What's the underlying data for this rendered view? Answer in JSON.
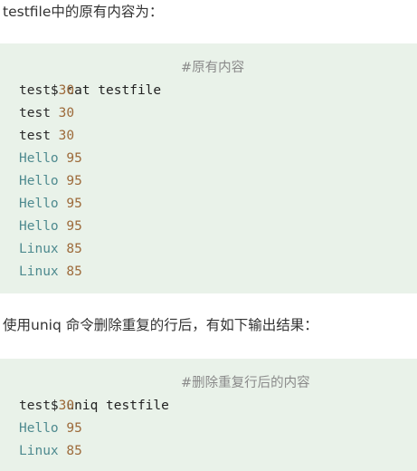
{
  "intro_text": "testfile中的原有内容为：",
  "block1": {
    "command": "$ cat testfile",
    "comment": "#原有内容",
    "lines": [
      {
        "word": "test",
        "num": "30",
        "cap": false
      },
      {
        "word": "test",
        "num": "30",
        "cap": false
      },
      {
        "word": "test",
        "num": "30",
        "cap": false
      },
      {
        "word": "Hello",
        "num": "95",
        "cap": true
      },
      {
        "word": "Hello",
        "num": "95",
        "cap": true
      },
      {
        "word": "Hello",
        "num": "95",
        "cap": true
      },
      {
        "word": "Hello",
        "num": "95",
        "cap": true
      },
      {
        "word": "Linux",
        "num": "85",
        "cap": true
      },
      {
        "word": "Linux",
        "num": "85",
        "cap": true
      }
    ]
  },
  "middle_text": "使用uniq 命令删除重复的行后，有如下输出结果：",
  "block2": {
    "command": "$ uniq testfile",
    "comment": "#删除重复行后的内容",
    "lines": [
      {
        "word": "test",
        "num": "30",
        "cap": false
      },
      {
        "word": "Hello",
        "num": "95",
        "cap": true
      },
      {
        "word": "Linux",
        "num": "85",
        "cap": true
      }
    ]
  },
  "colors": {
    "code_background": "#e9f2e9",
    "number": "#9d6a3a",
    "capitalized_word": "#4e8a8f",
    "comment": "#8a8a8a"
  }
}
